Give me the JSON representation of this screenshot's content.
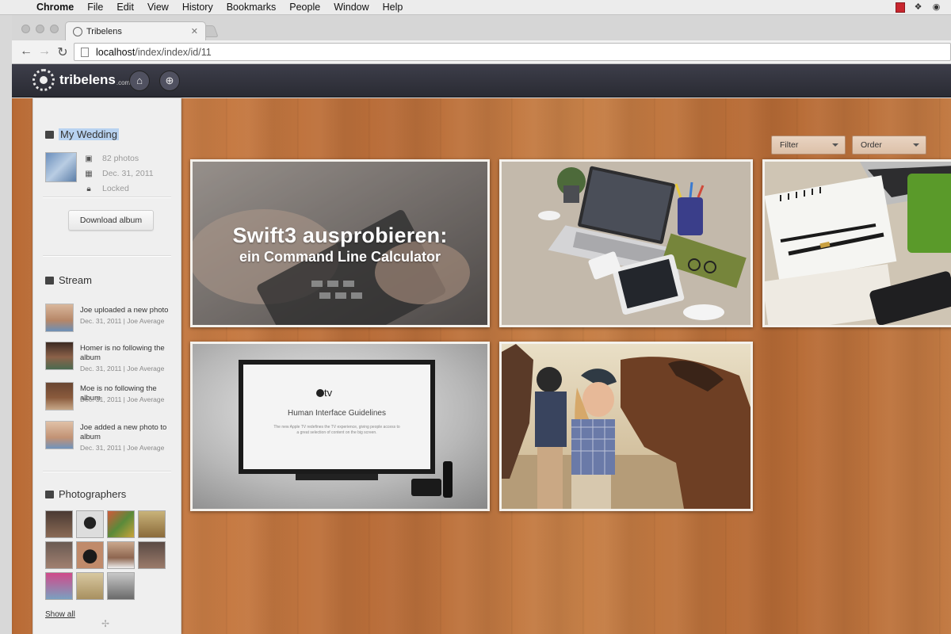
{
  "menubar": {
    "app": "Chrome",
    "items": [
      "File",
      "Edit",
      "View",
      "History",
      "Bookmarks",
      "People",
      "Window",
      "Help"
    ]
  },
  "browser": {
    "tab_title": "Tribelens",
    "url_host": "localhost",
    "url_path": "/index/index/id/11"
  },
  "app": {
    "logo_text": "tribelens",
    "logo_suffix": ".com"
  },
  "album": {
    "title": "My Wedding",
    "photos": "82 photos",
    "date": "Dec. 31, 2011",
    "status": "Locked",
    "download_label": "Download album"
  },
  "stream": {
    "title": "Stream",
    "items": [
      {
        "text": "Joe uploaded a new photo",
        "meta": "Dec. 31, 2011 | Joe Average"
      },
      {
        "text": "Homer is no following the album",
        "meta": "Dec. 31, 2011 | Joe Average"
      },
      {
        "text": "Moe is no following the album",
        "meta": "Dec. 31, 2011 | Joe Average"
      },
      {
        "text": "Joe added a new photo to album",
        "meta": "Dec. 31, 2011 | Joe Average"
      }
    ]
  },
  "photographers": {
    "title": "Photographers",
    "show_all": "Show all",
    "count": 11
  },
  "controls": {
    "filter_label": "Filter",
    "order_label": "Order"
  },
  "photos": {
    "swift_title_line1": "Swift3 ausprobieren:",
    "swift_title_line2": "ein Command Line Calculator",
    "appletv_brand": "tv",
    "appletv_heading": "Human Interface Guidelines",
    "appletv_body_line1": "The new Apple TV redefines the TV experience, giving people access to",
    "appletv_body_line2": "a great selection of content on the big screen."
  }
}
